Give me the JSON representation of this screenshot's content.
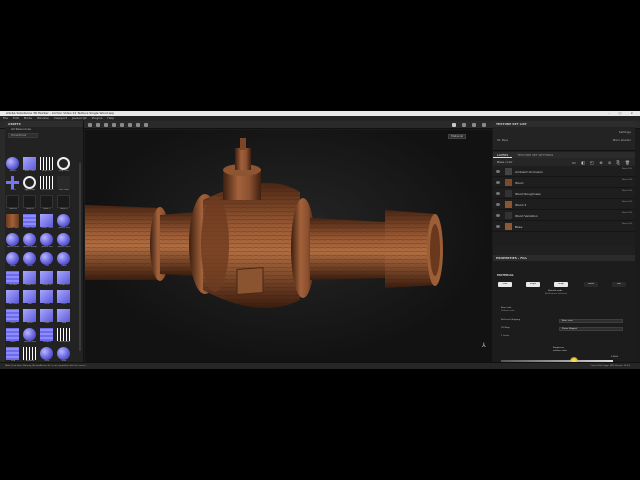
{
  "app": {
    "title": "Adobe Substance 3D Painter - Archon Video 21 Texture Single Wood.spp",
    "window_controls": [
      "–",
      "□",
      "×"
    ]
  },
  "menu": [
    "File",
    "Edit",
    "Mode",
    "Window",
    "Viewport",
    "Javascript",
    "Plugins",
    "Help"
  ],
  "assets_panel": {
    "title": "ASSETS",
    "subtitle": "All Resources",
    "filter": "Smartmat",
    "items": [
      {
        "label": "Sphere",
        "shape": "sphere"
      },
      {
        "label": "Blue Cube",
        "shape": "cube"
      },
      {
        "label": "Stripe Line",
        "shape": "stripe"
      },
      {
        "label": "Ring Circle",
        "shape": "ring"
      },
      {
        "label": "Cross",
        "shape": "cross"
      },
      {
        "label": "Egg Shape",
        "shape": "ring"
      },
      {
        "label": "Band Pattern",
        "shape": "stripe"
      },
      {
        "label": "Dark Mask",
        "shape": "dark"
      },
      {
        "label": "Mask A",
        "shape": "mask"
      },
      {
        "label": "Mask B",
        "shape": "mask"
      },
      {
        "label": "Mask C",
        "shape": "mask"
      },
      {
        "label": "Mask D",
        "shape": "mask"
      },
      {
        "label": "Wood Floor",
        "shape": "wood"
      },
      {
        "label": "Blue Tiles",
        "shape": "tile"
      },
      {
        "label": "Purple Cube",
        "shape": "cube"
      },
      {
        "label": "Sphere Soft",
        "shape": "sphere"
      },
      {
        "label": "Sphere Wide",
        "shape": "sphere"
      },
      {
        "label": "Sphere Bump",
        "shape": "sphere"
      },
      {
        "label": "Sphere Hex",
        "shape": "sphere"
      },
      {
        "label": "Sphere Mesh",
        "shape": "sphere"
      },
      {
        "label": "Ridge",
        "shape": "sphere"
      },
      {
        "label": "Knurl",
        "shape": "sphere"
      },
      {
        "label": "Orb",
        "shape": "sphere"
      },
      {
        "label": "Glass",
        "shape": "sphere"
      },
      {
        "label": "Tile Pack",
        "shape": "tile"
      },
      {
        "label": "Shape 01",
        "shape": "cube"
      },
      {
        "label": "Shape 02",
        "shape": "cube"
      },
      {
        "label": "Shape 03",
        "shape": "cube"
      },
      {
        "label": "Cube Stack",
        "shape": "cube"
      },
      {
        "label": "Bolt",
        "shape": "cube"
      },
      {
        "label": "Panel",
        "shape": "cube"
      },
      {
        "label": "Rivet",
        "shape": "cube"
      },
      {
        "label": "Lines",
        "shape": "tile"
      },
      {
        "label": "Sheet",
        "shape": "cube"
      },
      {
        "label": "Plate",
        "shape": "cube"
      },
      {
        "label": "Slab",
        "shape": "cube"
      },
      {
        "label": "Brick",
        "shape": "tile"
      },
      {
        "label": "Sphere Blue",
        "shape": "sphere"
      },
      {
        "label": "Hexgrid",
        "shape": "tile"
      },
      {
        "label": "Cross Hatch",
        "shape": "stripe"
      },
      {
        "label": "Grid",
        "shape": "tile"
      },
      {
        "label": "Brushed",
        "shape": "stripe"
      },
      {
        "label": "Gear",
        "shape": "sphere"
      },
      {
        "label": "Blob",
        "shape": "sphere"
      }
    ]
  },
  "viewport": {
    "mode": "Material",
    "axis_icon": "⅄"
  },
  "texture_set_list": {
    "title": "TEXTURE SET LIST",
    "settings_label": "Settings",
    "set_name": "01 Pipe",
    "shader": "Main shader"
  },
  "tabs": {
    "layers": "LAYERS",
    "settings": "TEXTURE SET SETTINGS"
  },
  "layers": {
    "channel": "Base color",
    "toolbar_icons": "▭ ◧ ◰ ⊕ ⊘ ⎘ 🗑",
    "rows": [
      {
        "name": "Ambient Occlusion",
        "blend": "Norm 100",
        "thumb": "#444"
      },
      {
        "name": "Wood",
        "blend": "Norm 100",
        "thumb": "#7a4a2a"
      },
      {
        "name": "Wood Roughness",
        "blend": "Norm 100",
        "thumb": "#333"
      },
      {
        "name": "Wood 2",
        "blend": "Norm 100",
        "thumb": "#8a5530"
      },
      {
        "name": "Wood Variation",
        "blend": "Norm 100",
        "thumb": "#333"
      },
      {
        "name": "Base",
        "blend": "Norm 100",
        "thumb": "#8d5a36"
      }
    ]
  },
  "properties": {
    "title": "PROPERTIES - FILL",
    "section": "MATERIAL",
    "mat_buttons": [
      "color",
      "height",
      "rough",
      "metal",
      "nrm"
    ],
    "material_mode": "Material mode",
    "no_resource": "No Resource Selected",
    "base_color_label": "Base color",
    "base_color_value": "Uniform color",
    "reflective_label": "Reflective Mapping",
    "reflective_value": "Basic color",
    "uv_label": "UV Wrap",
    "uv_value": "Planar Mapped",
    "u_label": "1 Levels",
    "tooltip_title": "Roughness",
    "tooltip_sub": "uniform value",
    "slider_value": "0.3560"
  },
  "status": {
    "message": "[Bake] Last bake: Warning 'Archon/Archon Ex' is not compatible with the current...",
    "right": "Cache Disk Usage: 38%  Version: 10.0.0"
  }
}
